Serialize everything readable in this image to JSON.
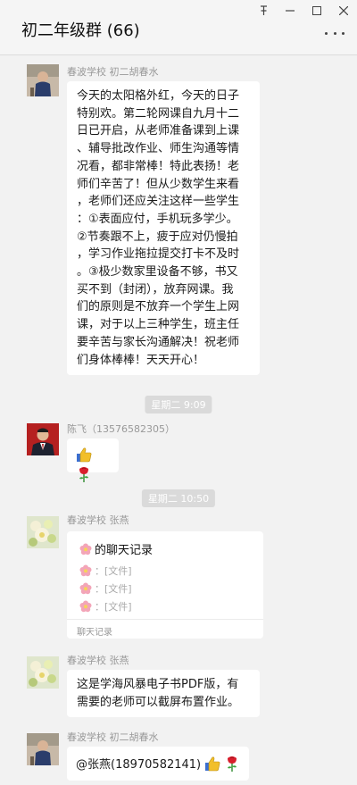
{
  "window": {
    "pin_icon": "pin-icon",
    "minimize_icon": "minimize-icon",
    "maximize_icon": "maximize-icon",
    "close_icon": "close-icon"
  },
  "header": {
    "title": "初二年级群 (66)",
    "more_icon": "more-icon"
  },
  "messages": [
    {
      "sender": "春波学校 初二胡春水",
      "lines": [
        "今天的太阳格外红，今天的日子",
        "特别欢。第二轮网课自九月十二",
        "日已开启，从老师准备课到上课",
        "、辅导批改作业、师生沟通等情",
        "况看，都非常棒！特此表扬！老",
        "师们辛苦了！但从少数学生来看",
        "，老师们还应关注这样一些学生",
        "：①表面应付，手机玩多学少。",
        "②节奏跟不上，疲于应对仍慢拍",
        "，学习作业拖拉提交打卡不及时",
        "。③极少数家里设备不够，书又",
        "买不到（封闭），放弃网课。我",
        "们的原则是不放弃一个学生上网",
        "课，对于以上三种学生，班主任",
        "要辛苦与家长沟通解决！祝老师",
        "们身体棒棒！天天开心！"
      ]
    },
    {
      "time": "星期二 9:09"
    },
    {
      "sender": "陈飞（13576582305）",
      "content_icons": [
        "thumbs-up-icon",
        "rose-icon"
      ]
    },
    {
      "time": "星期二 10:50"
    },
    {
      "sender": "春波学校 张燕",
      "record": {
        "title": "的聊天记录",
        "lines": [
          "：[文件]",
          "：[文件]",
          "：[文件]"
        ],
        "footer": "聊天记录"
      }
    },
    {
      "sender": "春波学校 张燕",
      "lines": [
        "这是学海风暴电子书PDF版，有",
        "需要的老师可以截屏布置作业。"
      ]
    },
    {
      "sender": "春波学校 初二胡春水",
      "text": "@张燕(18970582141)"
    }
  ],
  "colors": {
    "background": "#f2f2f2",
    "bubble": "#ffffff",
    "time_badge": "#dadada"
  }
}
